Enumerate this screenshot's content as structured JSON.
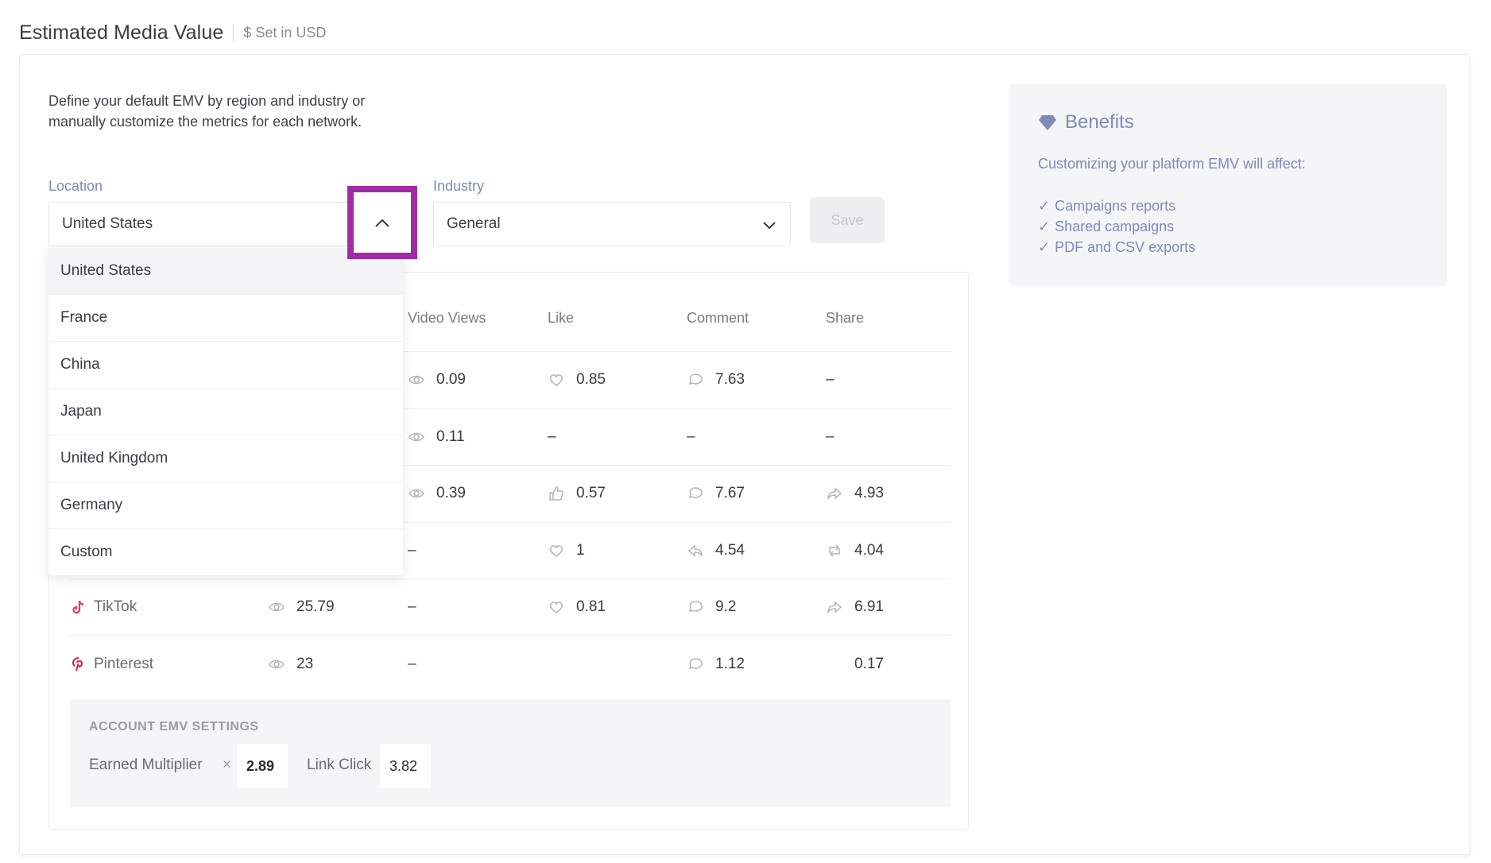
{
  "header": {
    "title": "Estimated Media Value",
    "subtitle": "$ Set in USD"
  },
  "intro": "Define your default EMV by region and industry or manually customize the metrics for each network.",
  "location": {
    "label": "Location",
    "value": "United States",
    "options": [
      "United States",
      "France",
      "China",
      "Japan",
      "United Kingdom",
      "Germany",
      "Custom"
    ]
  },
  "industry": {
    "label": "Industry",
    "value": "General"
  },
  "save_label": "Save",
  "table": {
    "columns": [
      "Video Views",
      "Like",
      "Comment",
      "Share"
    ],
    "rows": [
      {
        "network": "",
        "views": "",
        "video_views": "0.09",
        "like": "0.85",
        "comment": "7.63",
        "share": "–"
      },
      {
        "network": "",
        "views": "",
        "video_views": "0.11",
        "like": "–",
        "comment": "–",
        "share": "–"
      },
      {
        "network": "",
        "views": "",
        "video_views": "0.39",
        "like": "0.57",
        "comment": "7.67",
        "share": "4.93"
      },
      {
        "network": "",
        "views": "",
        "video_views": "–",
        "like": "1",
        "comment": "4.54",
        "share": "4.04"
      },
      {
        "network": "TikTok",
        "views": "25.79",
        "video_views": "–",
        "like": "0.81",
        "comment": "9.2",
        "share": "6.91"
      },
      {
        "network": "Pinterest",
        "views": "23",
        "video_views": "–",
        "like": "",
        "comment": "1.12",
        "share": "0.17"
      }
    ]
  },
  "account": {
    "title": "ACCOUNT EMV SETTINGS",
    "earned_label": "Earned Multiplier",
    "earned_symbol": "×",
    "earned_value": "2.89",
    "link_label": "Link Click",
    "link_value": "3.82"
  },
  "benefits": {
    "title": "Benefits",
    "desc": "Customizing your platform EMV will affect:",
    "items": [
      "Campaigns reports",
      "Shared campaigns",
      "PDF and CSV exports"
    ]
  },
  "colors": {
    "accent": "#7f8ab7",
    "highlight": "#a32aa6",
    "tiktok": "#e8336a",
    "pinterest": "#d6243b"
  }
}
